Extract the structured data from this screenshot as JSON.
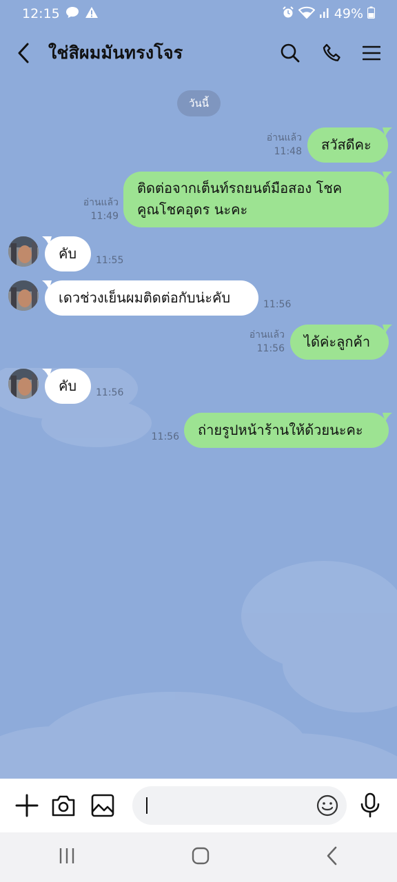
{
  "status": {
    "time": "12:15",
    "battery": "49%"
  },
  "header": {
    "title": "ใช่สิผมมันทรงโจร"
  },
  "chat": {
    "date_label": "วันนี้",
    "messages": [
      {
        "dir": "out",
        "lines": [
          "สวัสดีคะ"
        ],
        "read": "อ่านแล้ว",
        "time": "11:48"
      },
      {
        "dir": "out",
        "lines": [
          "ติดต่อจากเต็นท์รถยนต์มือสอง โชค",
          "คูณโชคอุดร นะคะ"
        ],
        "read": "อ่านแล้ว",
        "time": "11:49"
      },
      {
        "dir": "in",
        "lines": [
          "คับ"
        ],
        "time": "11:55"
      },
      {
        "dir": "in",
        "lines": [
          "เดวช่วงเย็นผมติดต่อกับน่ะคับ"
        ],
        "time": "11:56"
      },
      {
        "dir": "out",
        "lines": [
          "ได้ค่ะลูกค้า"
        ],
        "read": "อ่านแล้ว",
        "time": "11:56"
      },
      {
        "dir": "in",
        "lines": [
          "คับ"
        ],
        "time": "11:56"
      },
      {
        "dir": "out",
        "lines": [
          "ถ่ายรูปหน้าร้านให้ด้วยนะคะ"
        ],
        "time": "11:56"
      }
    ]
  },
  "input": {
    "value": ""
  },
  "icons": {
    "back": "chevron-left-icon",
    "search": "search-icon",
    "call": "phone-icon",
    "menu": "hamburger-menu-icon",
    "add": "plus-icon",
    "camera": "camera-icon",
    "gallery": "image-icon",
    "emoji": "emoji-icon",
    "mic": "microphone-icon"
  },
  "colors": {
    "background": "#8eabda",
    "outgoing_bubble": "#9de392",
    "incoming_bubble": "#ffffff"
  }
}
